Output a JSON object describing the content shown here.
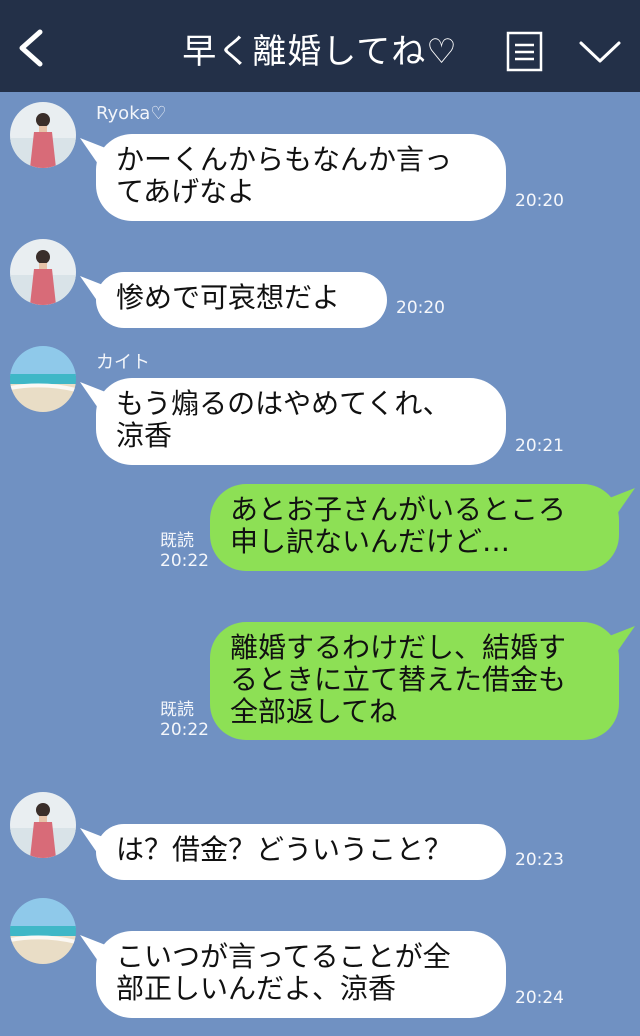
{
  "header": {
    "title": "早く離婚してね♡",
    "back_icon": "chevron-left-icon",
    "menu_icon": "menu-icon",
    "more_icon": "chevron-down-icon"
  },
  "colors": {
    "header_bg": "#233048",
    "chat_bg": "#7091c2",
    "incoming_bubble": "#ffffff",
    "outgoing_bubble": "#8de055"
  },
  "messages": [
    {
      "sender": "Ryoka♡",
      "text": "かーくんからもなんか言っ\nてあげなよ",
      "time": "20:20"
    },
    {
      "text": "惨めで可哀想だよ",
      "time": "20:20"
    },
    {
      "sender": "カイト",
      "text": "もう煽るのはやめてくれ、\n涼香",
      "time": "20:21"
    },
    {
      "text": "あとお子さんがいるところ\n申し訳ないんだけど…",
      "read": "既読",
      "time": "20:22"
    },
    {
      "text": "離婚するわけだし、結婚す\nるときに立て替えた借金も\n全部返してね",
      "read": "既読",
      "time": "20:22"
    },
    {
      "text": "は？借金？どういうこと？",
      "time": "20:23"
    },
    {
      "text": "こいつが言ってることが全\n部正しいんだよ、涼香",
      "time": "20:24"
    }
  ]
}
